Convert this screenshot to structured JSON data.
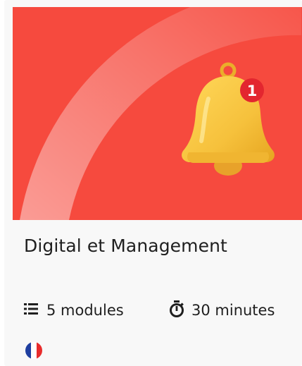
{
  "course": {
    "title": "Digital et Management",
    "modules_label": "5 modules",
    "duration_label": "30 minutes",
    "notification_count": "1",
    "language_flag": "french-flag-icon",
    "modules_icon": "list-icon",
    "duration_icon": "stopwatch-icon"
  },
  "colors": {
    "banner": "#f64a3e",
    "bell": "#f6c13c",
    "badge": "#e3262f",
    "text": "#1f1f1f",
    "flag_blue": "#1f3fa0",
    "flag_white": "#ffffff",
    "flag_red": "#e82c2c"
  }
}
